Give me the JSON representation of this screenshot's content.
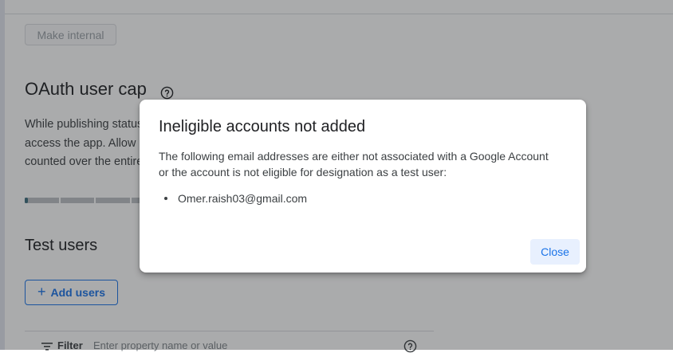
{
  "background": {
    "make_internal_label": "Make internal",
    "oauth_title": "OAuth user cap",
    "oauth_description_lines": [
      "While publishing status is",
      "access the app. Allow",
      "counted over the entire"
    ],
    "test_users_title": "Test users",
    "add_users_label": "Add users",
    "filter_label": "Filter",
    "filter_placeholder": "Enter property name or value"
  },
  "dialog": {
    "title": "Ineligible accounts not added",
    "body_lines": [
      "The following email addresses are either not associated with a Google Account",
      "or the account is not eligible for designation as a test user:"
    ],
    "emails": [
      "Omer.raish03@gmail.com"
    ],
    "close_label": "Close"
  },
  "icons": {
    "help": "help-circle-icon",
    "plus": "plus-icon",
    "filter": "filter-icon"
  },
  "colors": {
    "accent": "#1a73e8",
    "close_button_bg": "#e8f0fe",
    "scrim": "rgba(32,33,36,0.38)"
  }
}
